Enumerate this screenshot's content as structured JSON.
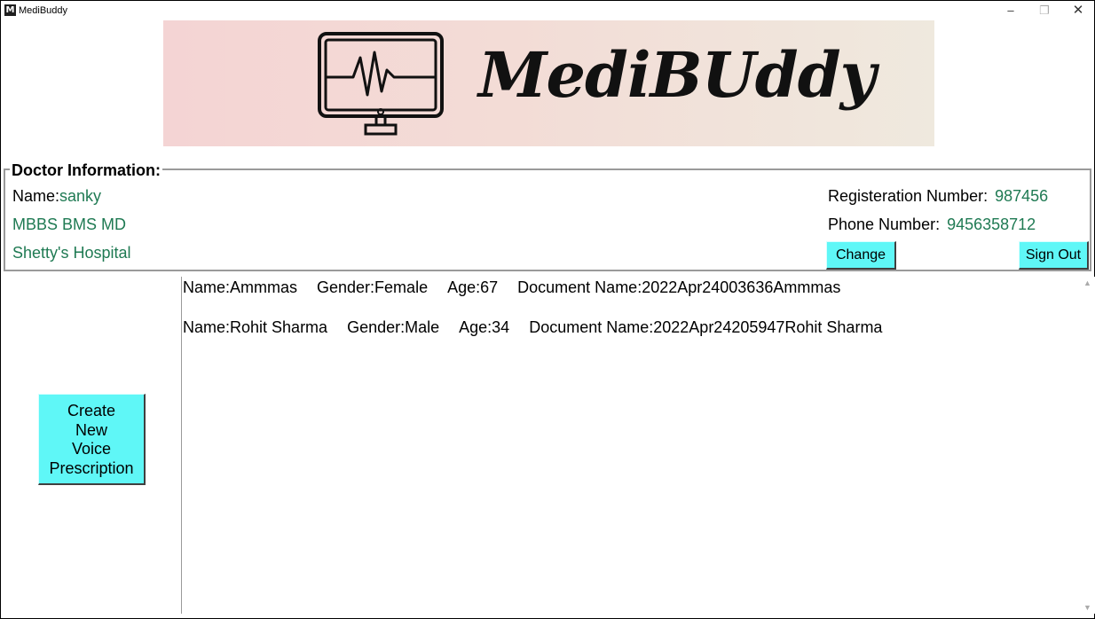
{
  "window": {
    "title": "MediBuddy",
    "app_icon_glyph": "M",
    "controls": {
      "minimize": "–",
      "maximize": "❐",
      "close": "✕"
    }
  },
  "banner": {
    "logo_text": "MediBUddy",
    "icon": "heart-monitor-icon",
    "gradient_colors": [
      "#f4d4d4",
      "#efe9de"
    ]
  },
  "doctor_info": {
    "legend": "Doctor Information:",
    "name_label": "Name:",
    "name_value": "sanky",
    "qualification": "MBBS BMS MD",
    "hospital": "Shetty's Hospital",
    "registration_label": "Registeration Number:",
    "registration_value": "987456",
    "phone_label": "Phone Number:",
    "phone_value": "9456358712",
    "change_button": "Change",
    "signout_button": "Sign Out"
  },
  "create_button": {
    "lines": [
      "Create",
      "New",
      "Voice",
      "Prescription"
    ]
  },
  "records": [
    {
      "name": "Name:Ammmas",
      "gender": "Gender:Female",
      "age": "Age:67",
      "document": "Document Name:2022Apr24003636Ammmas"
    },
    {
      "name": "Name:Rohit Sharma",
      "gender": "Gender:Male",
      "age": "Age:34",
      "document": "Document Name:2022Apr24205947Rohit Sharma"
    }
  ],
  "colors": {
    "button_bg": "#5ff7f7",
    "value_text": "#1f7a53",
    "group_border": "#9a9a9a"
  }
}
